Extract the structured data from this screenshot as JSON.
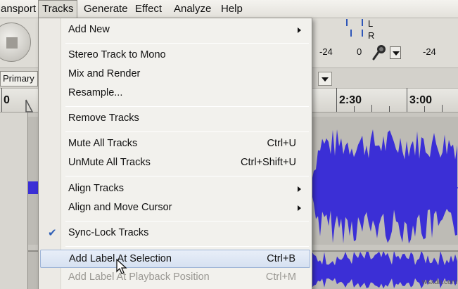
{
  "menubar": {
    "items": [
      "ansport",
      "Tracks",
      "Generate",
      "Effect",
      "Analyze",
      "Help"
    ],
    "active": "Tracks"
  },
  "toolbar": {
    "meter_left_label": "L",
    "meter_right_label": "R",
    "meter_scale": [
      "-24",
      "0",
      "-24"
    ],
    "device_label": "Primary S"
  },
  "ruler": {
    "labels": [
      "0",
      "2:30",
      "3:00"
    ]
  },
  "tracks_menu": {
    "add_new": "Add New",
    "stereo_to_mono": "Stereo Track to Mono",
    "mix_and_render": "Mix and Render",
    "resample": "Resample...",
    "remove_tracks": "Remove Tracks",
    "mute_all": "Mute All Tracks",
    "mute_all_shortcut": "Ctrl+U",
    "unmute_all": "UnMute All Tracks",
    "unmute_all_shortcut": "Ctrl+Shift+U",
    "align_tracks": "Align Tracks",
    "align_and_move": "Align and Move Cursor",
    "sync_lock": "Sync-Lock Tracks",
    "sync_lock_checked": true,
    "add_label_selection": "Add Label At Selection",
    "add_label_selection_shortcut": "Ctrl+B",
    "add_label_playback": "Add Label At Playback Position",
    "add_label_playback_shortcut": "Ctrl+M"
  },
  "colors": {
    "waveform": "#3b2fd6",
    "menu_highlight": "#d6e1f1",
    "checkmark": "#2f5fb6"
  },
  "watermark": "wsxdn.com"
}
